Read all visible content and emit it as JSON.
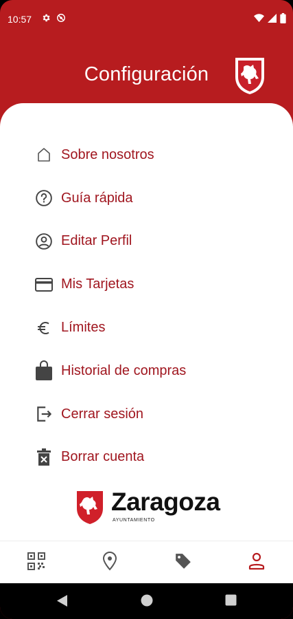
{
  "status_bar": {
    "time": "10:57",
    "left_icons": [
      "gear-icon",
      "no-disturb-icon"
    ],
    "right_icons": [
      "wifi-icon",
      "signal-icon",
      "battery-icon"
    ]
  },
  "header": {
    "title": "Configuración",
    "background_color": "#b71c1f"
  },
  "menu": {
    "text_color": "#a0161f",
    "items": [
      {
        "label": "Sobre nosotros",
        "icon": "home-icon"
      },
      {
        "label": "Guía rápida",
        "icon": "help-icon"
      },
      {
        "label": "Editar Perfil",
        "icon": "profile-icon"
      },
      {
        "label": "Mis Tarjetas",
        "icon": "credit-card-icon"
      },
      {
        "label": "Límites",
        "icon": "euro-icon"
      },
      {
        "label": "Historial de compras",
        "icon": "shopping-bag-icon"
      },
      {
        "label": "Cerrar sesión",
        "icon": "logout-icon"
      },
      {
        "label": "Borrar cuenta",
        "icon": "delete-icon"
      }
    ]
  },
  "logo": {
    "name": "Zaragoza",
    "subtitle": "AYUNTAMIENTO"
  },
  "bottom_nav": {
    "items": [
      "qr-code-icon",
      "location-icon",
      "tag-icon",
      "person-icon"
    ],
    "active": "person-icon",
    "active_color": "#b71c1f"
  },
  "system_nav": [
    "back-icon",
    "home-circle-icon",
    "recents-icon"
  ]
}
